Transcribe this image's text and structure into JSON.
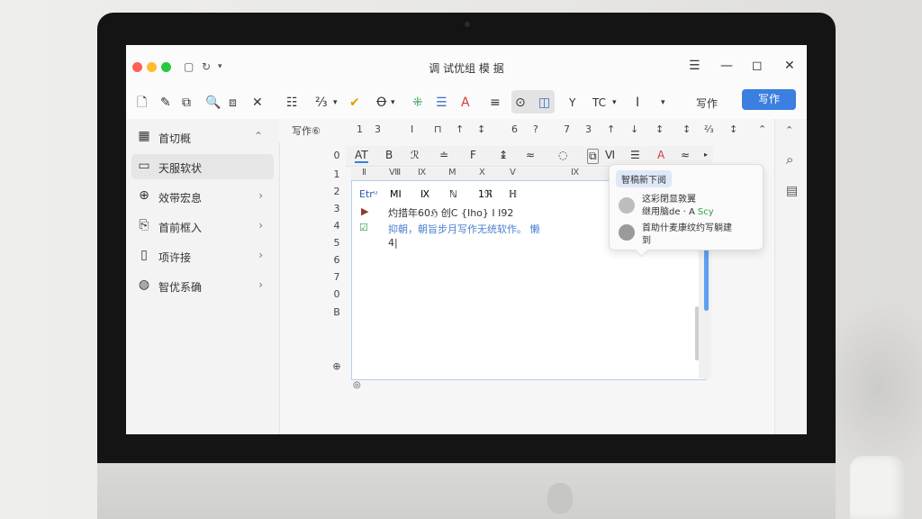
{
  "window": {
    "title": "调   试优组   模   据",
    "controls": {
      "filter": "☰",
      "minimize": "—",
      "maximize": "◻",
      "close": "✕"
    },
    "left_glyphs": [
      "▢",
      "↻",
      "▾"
    ]
  },
  "toolbar": {
    "tools": [
      "🗋",
      "✎",
      "⧉",
      "🔍",
      "⧈",
      "✕",
      "☷",
      "⅔",
      "▾",
      "✔",
      "Ꝋ",
      "▾",
      "⁜",
      "☰",
      "A",
      "≡",
      "⊙",
      "◫",
      "Y",
      "TC",
      "▾",
      "I",
      "▾"
    ],
    "write_label": "写作",
    "write_button": "写作"
  },
  "sidebar": {
    "items": [
      {
        "icon": "grid-icon",
        "glyph": "▦",
        "label": "首切概",
        "chevron": "⌃"
      },
      {
        "icon": "image-icon",
        "glyph": "▭",
        "label": "天服软状",
        "chevron": ""
      },
      {
        "icon": "plus-circle-icon",
        "glyph": "⊕",
        "label": "效带宏息",
        "chevron": "›"
      },
      {
        "icon": "import-icon",
        "glyph": "⎘",
        "label": "首前框入",
        "chevron": "›"
      },
      {
        "icon": "document-icon",
        "glyph": "▯",
        "label": "项许接",
        "chevron": "›"
      },
      {
        "icon": "chat-icon",
        "glyph": "◍",
        "label": "智优系确",
        "chevron": "›"
      }
    ]
  },
  "ruler": {
    "label": "写作⑥",
    "marks": [
      "1",
      "3",
      "Ι",
      "⊓",
      "↑",
      "↕",
      "6",
      "?",
      "7",
      "3",
      "↑",
      "↓",
      "↕",
      "↕",
      "⅔",
      "↕",
      "⌃"
    ]
  },
  "format_bar": {
    "items": [
      "AT",
      "B",
      "ℛ",
      "≐",
      "F",
      "↨",
      "≈",
      "◌",
      "⧉",
      "Ⅵ",
      "☰",
      "A",
      "≈",
      "▸"
    ]
  },
  "column_headers": [
    "Ⅱ",
    "Ⅷ",
    "Ⅸ",
    "M",
    "Ⅹ",
    "Ⅴ",
    "Ⅸ"
  ],
  "line_numbers": [
    "0",
    "1",
    "2",
    "3",
    "4",
    "5",
    "6",
    "7",
    "0",
    "B",
    "⊕"
  ],
  "document": {
    "row2": [
      "Etrᵘ",
      "MΙ",
      "Ⅸ",
      "ℕ",
      "1ℜ",
      "ℍ"
    ],
    "row3_text": "灼措年60ℌ 创Ⅽ {Iho} Ⅰ  Ⅰ92",
    "row4_text": "抑朝，朝旨步月写作无统软作。 懒",
    "row5_text": "4|",
    "bottom_mark": "◎"
  },
  "popup": {
    "title": "智稿新下阅",
    "item1_line1": "这彩閉显敦翼",
    "item1_line2_prefix": "继用脑de · A",
    "item1_line2_accent": "Scy",
    "item2_line1": "首助什麦康纹约写躺建",
    "item2_line2": "到"
  },
  "right_panel": {
    "search": "⌕",
    "clipboard": "▤",
    "chevron": "⌃"
  },
  "colors": {
    "accent": "#3b7fe0",
    "traffic_red": "#fe5f57",
    "traffic_yellow": "#febc2e",
    "traffic_green": "#28c840",
    "link_blue": "#4a7fd0",
    "mark_red": "#c0392b"
  }
}
